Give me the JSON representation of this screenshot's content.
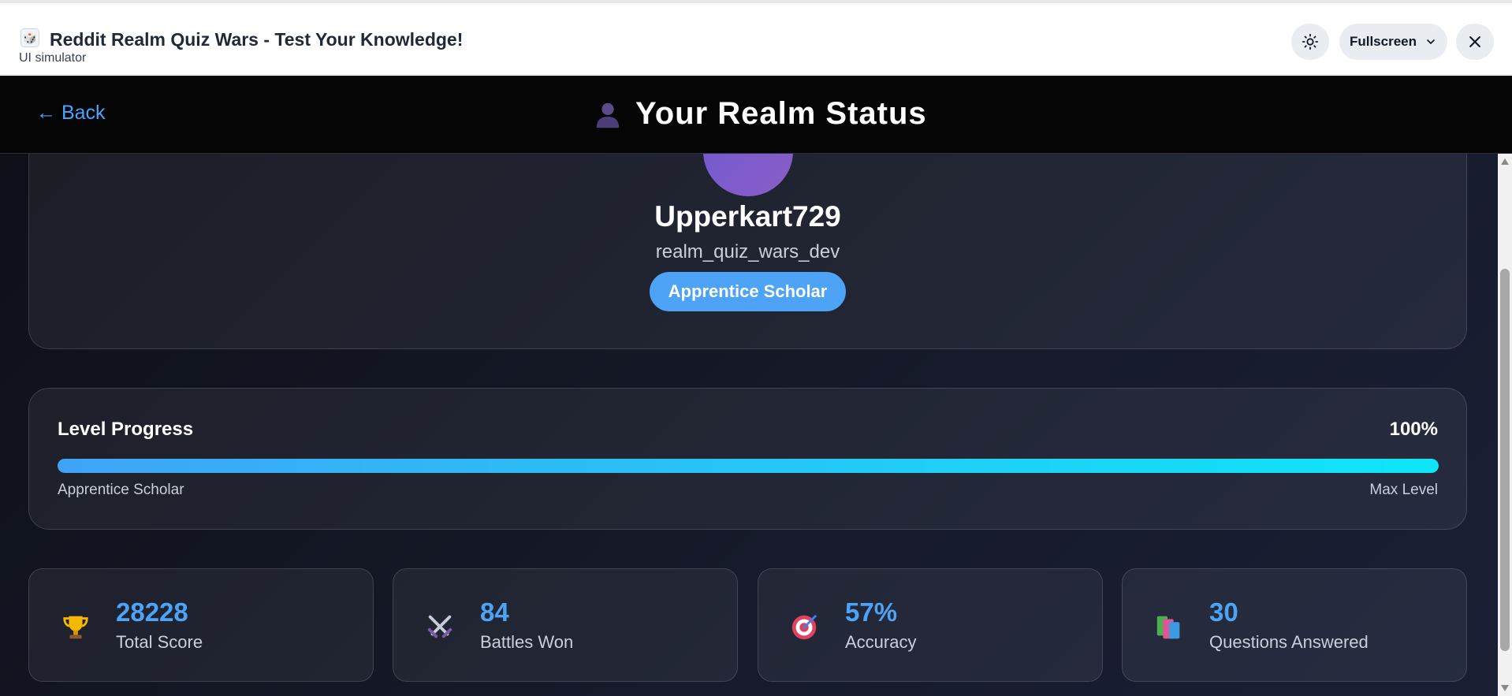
{
  "window": {
    "title": "Reddit Realm Quiz Wars - Test Your Knowledge!",
    "subtitle": "UI simulator",
    "fullscreen_label": "Fullscreen",
    "icons": {
      "app": "app-icon",
      "theme": "sun-icon",
      "fullscreen": "chevron-down-icon",
      "close": "close-icon"
    }
  },
  "header": {
    "back_label": "← Back",
    "title": "Your Realm Status",
    "title_icon": "user-silhouette-icon"
  },
  "profile": {
    "username": "Upperkart729",
    "handle": "realm_quiz_wars_dev",
    "rank": "Apprentice Scholar"
  },
  "progress": {
    "title": "Level Progress",
    "percent_label": "100%",
    "percent_value": 100,
    "current_level": "Apprentice Scholar",
    "next_level": "Max Level"
  },
  "stats": [
    {
      "icon": "trophy-icon",
      "value": "28228",
      "label": "Total Score"
    },
    {
      "icon": "crossed-swords-icon",
      "value": "84",
      "label": "Battles Won"
    },
    {
      "icon": "target-icon",
      "value": "57%",
      "label": "Accuracy"
    },
    {
      "icon": "books-icon",
      "value": "30",
      "label": "Questions Answered"
    }
  ],
  "colors": {
    "accent": "#4da3f5",
    "progress_start": "#3fa4f6",
    "progress_end": "#0ee6f7",
    "header_bg": "#050505"
  }
}
